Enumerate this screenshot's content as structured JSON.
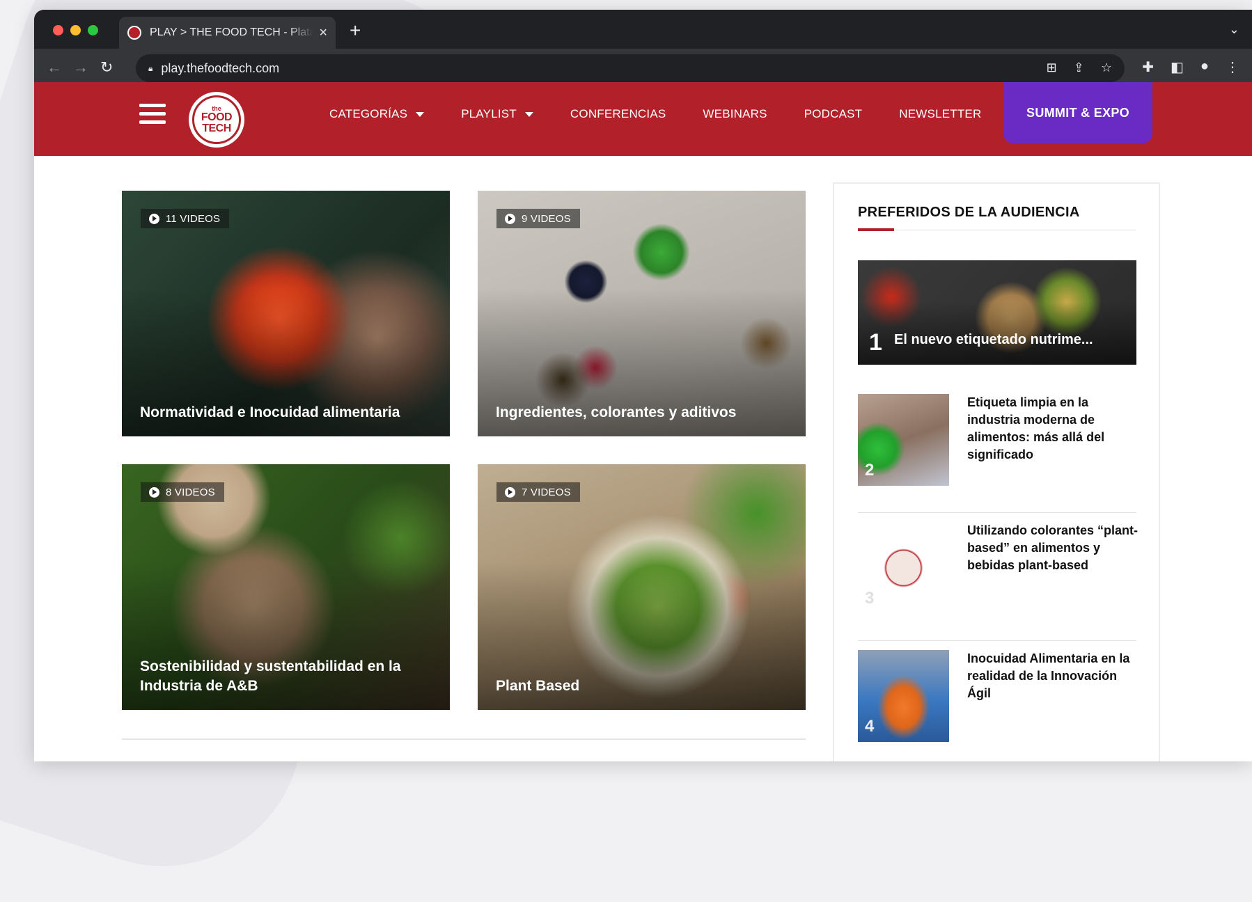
{
  "browser": {
    "tab_title": "PLAY > THE FOOD TECH - Plataforma",
    "tab_close": "×",
    "new_tab": "+",
    "url": "play.thefoodtech.com",
    "traffic_lights": [
      "#ff5f57",
      "#febc2e",
      "#28c840"
    ]
  },
  "site": {
    "logo": {
      "the": "the",
      "line1": "FOOD",
      "line2": "TECH"
    },
    "nav": [
      {
        "label": "CATEGORÍAS",
        "dropdown": true
      },
      {
        "label": "PLAYLIST",
        "dropdown": true
      },
      {
        "label": "CONFERENCIAS",
        "dropdown": false
      },
      {
        "label": "WEBINARS",
        "dropdown": false
      },
      {
        "label": "PODCAST",
        "dropdown": false
      },
      {
        "label": "NEWSLETTER",
        "dropdown": false
      }
    ],
    "summit_button": "SUMMIT & EXPO",
    "colors": {
      "brand_red": "#b22029",
      "summit_purple": "#6a2bc4"
    }
  },
  "cards": [
    {
      "badge": "11 VIDEOS",
      "title": "Normatividad e Inocuidad alimentaria",
      "image": "pepper-tech-hands"
    },
    {
      "badge": "9 VIDEOS",
      "title": "Ingredientes, colorantes y aditivos",
      "image": "spoons-spices-table"
    },
    {
      "badge": "8 VIDEOS",
      "title": "Sostenibilidad y sustentabilidad en la Industria de A&B",
      "image": "eco-tableware-moss"
    },
    {
      "badge": "7 VIDEOS",
      "title": "Plant Based",
      "image": "salad-bowl"
    }
  ],
  "sidebar": {
    "title": "PREFERIDOS DE LA AUDIENCIA",
    "featured": {
      "number": "1",
      "title": "El nuevo etiquetado nutrime..."
    },
    "items": [
      {
        "number": "2",
        "title": "Etiqueta limpia en la industria moderna de alimentos: más allá del significado"
      },
      {
        "number": "3",
        "title": "Utilizando colorantes “plant-based” en alimentos y bebidas plant-based"
      },
      {
        "number": "4",
        "title": "Inocuidad Alimentaria en la realidad de la Innovación Ágil"
      }
    ]
  }
}
